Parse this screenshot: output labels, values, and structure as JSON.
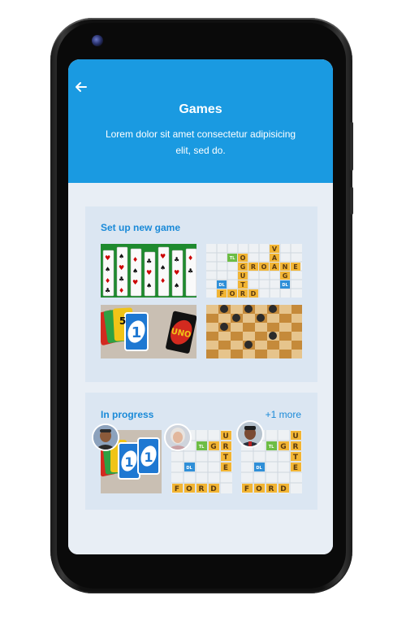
{
  "header": {
    "title": "Games",
    "subtitle": "Lorem dolor sit amet consectetur adipisicing elit, sed do."
  },
  "new_game": {
    "title": "Set up new game",
    "games": [
      {
        "name": "solitaire"
      },
      {
        "name": "word-game"
      },
      {
        "name": "uno"
      },
      {
        "name": "checkers"
      }
    ]
  },
  "in_progress": {
    "title": "In progress",
    "more_label": "+1 more",
    "games": [
      {
        "name": "uno",
        "player": "player-1"
      },
      {
        "name": "word-game",
        "player": "player-2"
      },
      {
        "name": "word-game",
        "player": "player-3"
      }
    ]
  },
  "word_tiles": {
    "row1": [
      "G",
      "R",
      "O",
      "A",
      "N",
      "E"
    ],
    "col": [
      "U",
      "T",
      "E",
      "D"
    ],
    "bottom": [
      "F",
      "O",
      "R",
      "D"
    ],
    "side": [
      "V",
      "A",
      "O",
      "G",
      "F"
    ],
    "bonus": [
      "TL",
      "DL",
      "TL",
      "DL"
    ]
  },
  "uno": {
    "logo": "UNO",
    "cards": [
      "5",
      "1"
    ]
  },
  "icons": {
    "back": "arrow-left-icon"
  },
  "colors": {
    "header": "#1a9ae1",
    "accent": "#1a8ad8",
    "card_bg": "#dbe6f2"
  }
}
